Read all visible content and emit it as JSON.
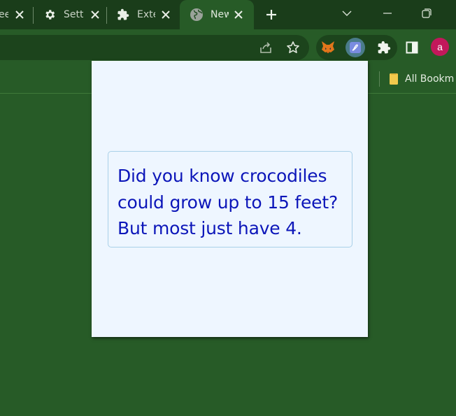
{
  "tabs": [
    {
      "label": "ee",
      "active": false,
      "icon": "partial-tab-icon"
    },
    {
      "label": "Sett",
      "active": false,
      "icon": "gear-icon"
    },
    {
      "label": "Exte",
      "active": false,
      "icon": "puzzle-icon"
    },
    {
      "label": "New",
      "active": true,
      "icon": "globe-icon"
    }
  ],
  "window_controls": [
    "tab-search-icon",
    "minimize-icon",
    "restore-icon"
  ],
  "toolbar": {
    "actions": [
      "share-icon",
      "star-icon"
    ],
    "extensions": [
      "metamask-fox-icon",
      "extension-pen-icon"
    ],
    "extras": [
      "puzzle-icon",
      "side-panel-icon"
    ],
    "profile_initial": "a"
  },
  "bookmarks": {
    "all_bookmarks_label": "All Bookm"
  },
  "popup": {
    "fact_lines": [
      "Did you know crocodiles",
      "could grow up to 15 feet?",
      "But most just have 4."
    ]
  },
  "colors": {
    "frame": "#1a3d1a",
    "toolbar": "#275b27",
    "popup_bg": "#eef6ff",
    "card_border": "#a9d0e8",
    "fact_text": "#0c16b9",
    "profile_bg": "#c2185b"
  }
}
